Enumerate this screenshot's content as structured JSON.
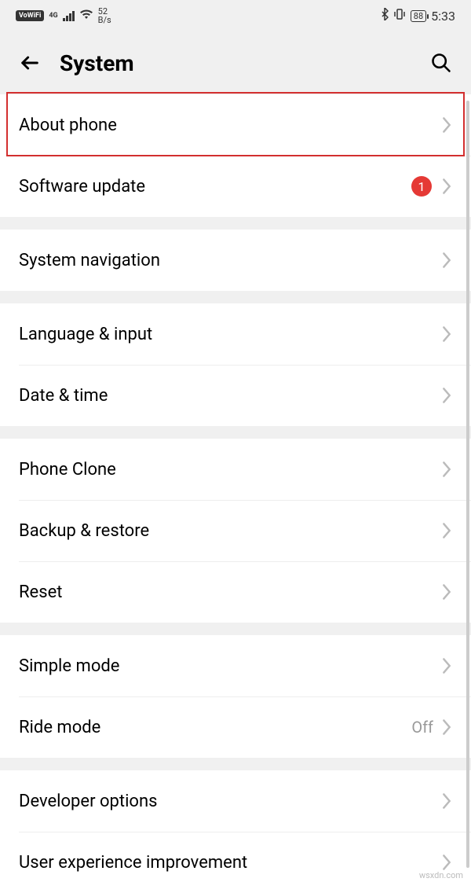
{
  "status": {
    "vowifi": "VoWiFi",
    "net_gen": "4G",
    "speed_num": "52",
    "speed_unit": "B/s",
    "battery": "88",
    "time": "5:33"
  },
  "header": {
    "title": "System"
  },
  "groups": [
    {
      "items": [
        {
          "label": "About phone",
          "badge": null,
          "value": null,
          "highlighted": true
        },
        {
          "label": "Software update",
          "badge": "1",
          "value": null
        }
      ]
    },
    {
      "items": [
        {
          "label": "System navigation",
          "badge": null,
          "value": null
        }
      ]
    },
    {
      "items": [
        {
          "label": "Language & input",
          "badge": null,
          "value": null
        },
        {
          "label": "Date & time",
          "badge": null,
          "value": null
        }
      ]
    },
    {
      "items": [
        {
          "label": "Phone Clone",
          "badge": null,
          "value": null
        },
        {
          "label": "Backup & restore",
          "badge": null,
          "value": null
        },
        {
          "label": "Reset",
          "badge": null,
          "value": null
        }
      ]
    },
    {
      "items": [
        {
          "label": "Simple mode",
          "badge": null,
          "value": null
        },
        {
          "label": "Ride mode",
          "badge": null,
          "value": "Off"
        }
      ]
    },
    {
      "items": [
        {
          "label": "Developer options",
          "badge": null,
          "value": null
        },
        {
          "label": "User experience improvement",
          "badge": null,
          "value": null
        }
      ]
    }
  ],
  "watermark": "wsxdn.com"
}
